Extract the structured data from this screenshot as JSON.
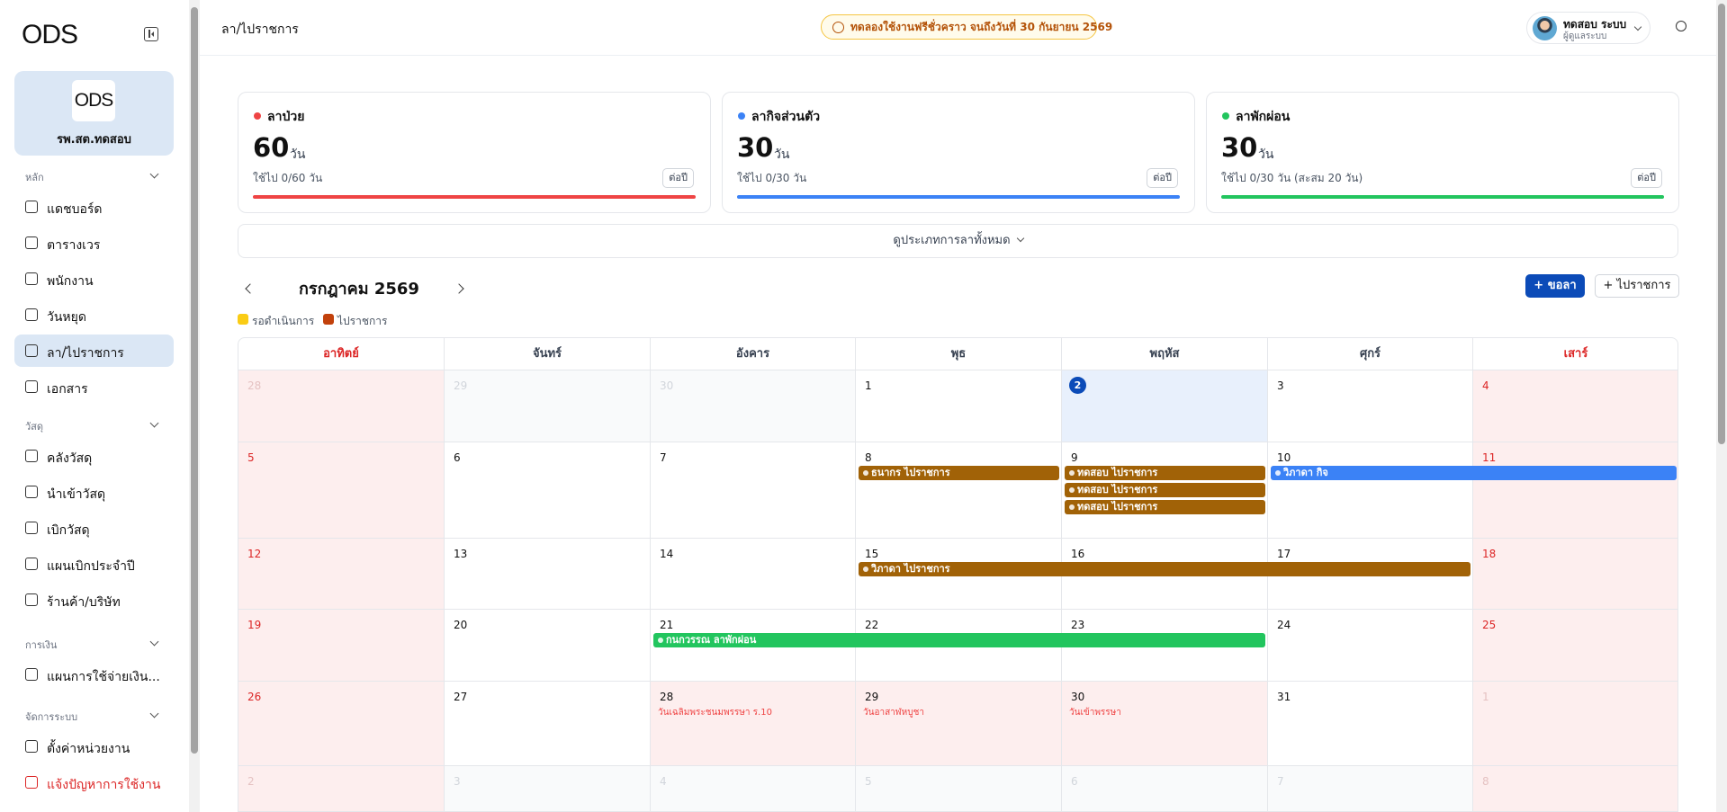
{
  "sidebar": {
    "logo": "ODS",
    "org": {
      "logo": "ODS",
      "name": "รพ.สต.ทดสอบ"
    },
    "groups": [
      {
        "label": "หลัก",
        "items": [
          {
            "label": "แดชบอร์ด",
            "icon": "grid-icon"
          },
          {
            "label": "ตารางเวร",
            "icon": "calendar-icon"
          },
          {
            "label": "พนักงาน",
            "icon": "users-icon"
          },
          {
            "label": "วันหยุด",
            "icon": "calendar-off-icon"
          },
          {
            "label": "ลา/ไปราชการ",
            "icon": "calendar-check-icon",
            "active": true
          },
          {
            "label": "เอกสาร",
            "icon": "document-icon"
          }
        ]
      },
      {
        "label": "วัสดุ",
        "items": [
          {
            "label": "คลังวัสดุ",
            "icon": "box-icon"
          },
          {
            "label": "นำเข้าวัสดุ",
            "icon": "box-in-icon"
          },
          {
            "label": "เบิกวัสดุ",
            "icon": "box-out-icon"
          },
          {
            "label": "แผนเบิกประจำปี",
            "icon": "clipboard-icon"
          },
          {
            "label": "ร้านค้า/บริษัท",
            "icon": "store-icon"
          }
        ]
      },
      {
        "label": "การเงิน",
        "items": [
          {
            "label": "แผนการใช้จ่ายเงิน...",
            "icon": "wallet-icon"
          }
        ]
      },
      {
        "label": "จัดการระบบ",
        "items": [
          {
            "label": "ตั้งค่าหน่วยงาน",
            "icon": "gear-icon"
          },
          {
            "label": "แจ้งปัญหาการใช้งาน",
            "icon": "alert-icon",
            "report": true
          }
        ]
      }
    ]
  },
  "header": {
    "title": "ลา/ไปราชการ",
    "trial": "ทดลองใช้งานฟรีชั่วคราว จนถึงวันที่ 30 กันยายน 2569",
    "user_name": "ทดสอบ ระบบ",
    "user_role": "ผู้ดูแลระบบ"
  },
  "cards": [
    {
      "title": "ลาป่วย",
      "days": "60",
      "unit": "วัน",
      "used": "ใช้ไป 0/60 วัน",
      "period": "ต่อปี",
      "color": "#ef4444"
    },
    {
      "title": "ลากิจส่วนตัว",
      "days": "30",
      "unit": "วัน",
      "used": "ใช้ไป 0/30 วัน",
      "period": "ต่อปี",
      "color": "#3b82f6"
    },
    {
      "title": "ลาพักผ่อน",
      "days": "30",
      "unit": "วัน",
      "used": "ใช้ไป 0/30 วัน (สะสม 20 วัน)",
      "period": "ต่อปี",
      "color": "#22c55e"
    }
  ],
  "view_all": "ดูประเภทการลาทั้งหมด",
  "calendar": {
    "month_title": "กรกฎาคม 2569",
    "btn_leave": "+ ขอลา",
    "btn_official": "+ ไปราชการ",
    "legend": [
      {
        "label": "รอดำเนินการ",
        "color": "#facc15"
      },
      {
        "label": "ไปราชการ",
        "color": "#c2410c"
      }
    ],
    "days_of_week": [
      "อาทิตย์",
      "จันทร์",
      "อังคาร",
      "พุธ",
      "พฤหัส",
      "ศุกร์",
      "เสาร์"
    ],
    "weeks": [
      [
        {
          "d": "28",
          "o": true
        },
        {
          "d": "29",
          "o": true
        },
        {
          "d": "30",
          "o": true
        },
        {
          "d": "1"
        },
        {
          "d": "2",
          "today": true
        },
        {
          "d": "3"
        },
        {
          "d": "4"
        }
      ],
      [
        {
          "d": "5"
        },
        {
          "d": "6"
        },
        {
          "d": "7"
        },
        {
          "d": "8"
        },
        {
          "d": "9"
        },
        {
          "d": "10"
        },
        {
          "d": "11"
        }
      ],
      [
        {
          "d": "12"
        },
        {
          "d": "13"
        },
        {
          "d": "14"
        },
        {
          "d": "15"
        },
        {
          "d": "16"
        },
        {
          "d": "17"
        },
        {
          "d": "18"
        }
      ],
      [
        {
          "d": "19"
        },
        {
          "d": "20"
        },
        {
          "d": "21"
        },
        {
          "d": "22"
        },
        {
          "d": "23"
        },
        {
          "d": "24"
        },
        {
          "d": "25"
        }
      ],
      [
        {
          "d": "26"
        },
        {
          "d": "27"
        },
        {
          "d": "28",
          "hol": "วันเฉลิมพระชนมพรรษา ร.10"
        },
        {
          "d": "29",
          "hol": "วันอาสาฬหบูชา"
        },
        {
          "d": "30",
          "hol": "วันเข้าพรรษา"
        },
        {
          "d": "31"
        },
        {
          "d": "1",
          "o": true
        }
      ],
      [
        {
          "d": "2",
          "o": true
        },
        {
          "d": "3",
          "o": true
        },
        {
          "d": "4",
          "o": true
        },
        {
          "d": "5",
          "o": true
        },
        {
          "d": "6",
          "o": true
        },
        {
          "d": "7",
          "o": true
        },
        {
          "d": "8",
          "o": true
        }
      ]
    ],
    "events": [
      {
        "week": 1,
        "start": 3,
        "span": 1,
        "slot": 0,
        "type": "official",
        "label": "ธนากร ไปราชการ"
      },
      {
        "week": 1,
        "start": 4,
        "span": 1,
        "slot": 0,
        "type": "official",
        "label": "ทดสอบ ไปราชการ"
      },
      {
        "week": 1,
        "start": 4,
        "span": 1,
        "slot": 1,
        "type": "official",
        "label": "ทดสอบ ไปราชการ"
      },
      {
        "week": 1,
        "start": 4,
        "span": 1,
        "slot": 2,
        "type": "official",
        "label": "ทดสอบ ไปราชการ"
      },
      {
        "week": 1,
        "start": 5,
        "span": 2,
        "slot": 0,
        "type": "personal",
        "label": "วิภาดา กิจ"
      },
      {
        "week": 2,
        "start": 3,
        "span": 3,
        "slot": 0,
        "type": "official",
        "label": "วิภาดา ไปราชการ"
      },
      {
        "week": 3,
        "start": 2,
        "span": 3,
        "slot": 0,
        "type": "vacation",
        "label": "กนกวรรณ ลาพักผ่อน"
      }
    ]
  }
}
